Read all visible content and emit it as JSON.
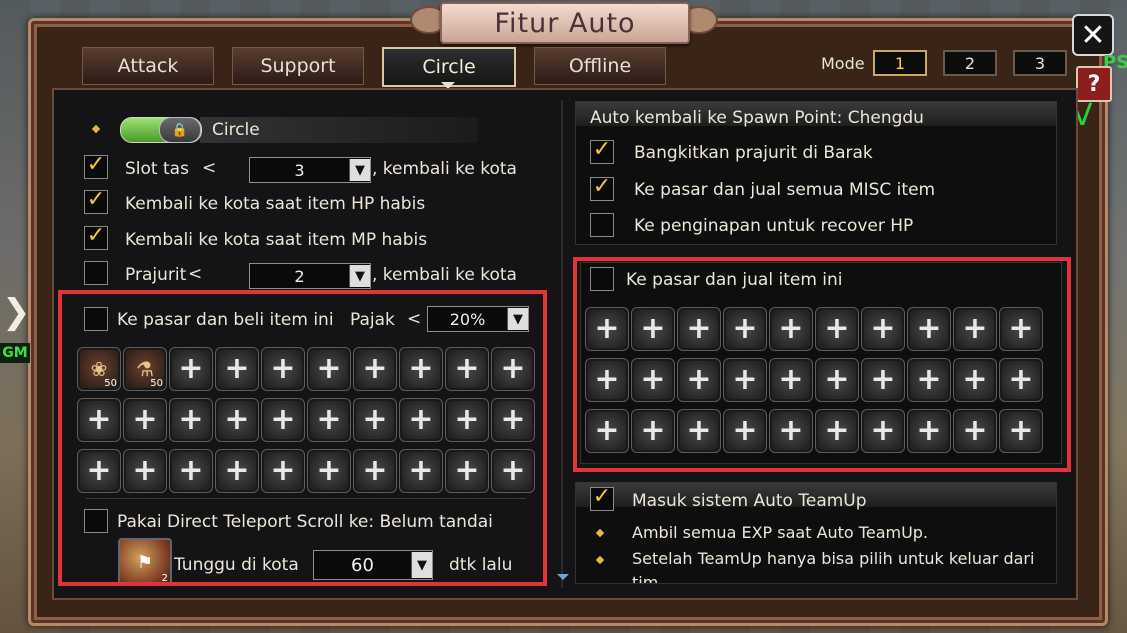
{
  "window": {
    "title": "Fitur Auto"
  },
  "tabs": [
    {
      "label": "Attack",
      "active": false
    },
    {
      "label": "Support",
      "active": false
    },
    {
      "label": "Circle",
      "active": true
    },
    {
      "label": "Offline",
      "active": false
    }
  ],
  "mode": {
    "label": "Mode",
    "options": [
      "1",
      "2",
      "3"
    ],
    "selected": "1"
  },
  "side": {
    "ps": "PS",
    "v": "V",
    "gm": "GM",
    "help": "?",
    "close": "✕"
  },
  "left": {
    "circle_toggle": {
      "label": "Circle",
      "on": true
    },
    "slot_row": {
      "checked": true,
      "label": "Slot tas",
      "op": "<",
      "value": "3",
      "suffix": ", kembali ke kota"
    },
    "hp_row": {
      "checked": true,
      "label": "Kembali ke kota saat item HP habis"
    },
    "mp_row": {
      "checked": true,
      "label": "Kembali ke kota saat item MP habis"
    },
    "soldier_row": {
      "checked": false,
      "label": "Prajurit",
      "op": "<",
      "value": "2",
      "suffix": ", kembali ke kota"
    },
    "buy": {
      "checked": false,
      "label": "Ke pasar dan beli item ini",
      "tax_label": "Pajak",
      "tax_op": "<",
      "tax_value": "20%",
      "items": [
        {
          "qty": "50",
          "icon": "hp-potion-icon"
        },
        {
          "qty": "50",
          "icon": "mp-potion-icon"
        }
      ]
    },
    "teleport": {
      "checked": false,
      "label": "Pakai Direct Teleport Scroll ke: Belum tandai",
      "scroll_qty": "2",
      "wait_label": "Tunggu di kota",
      "wait_value": "60",
      "wait_suffix": "dtk lalu"
    }
  },
  "right": {
    "spawn": {
      "header": "Auto kembali ke Spawn Point: Chengdu",
      "rows": [
        {
          "checked": true,
          "label": "Bangkitkan prajurit di Barak"
        },
        {
          "checked": true,
          "label": "Ke pasar dan jual semua MISC item"
        },
        {
          "checked": false,
          "label": "Ke penginapan untuk recover HP"
        }
      ]
    },
    "sell": {
      "checked": false,
      "label": "Ke pasar dan jual item ini"
    },
    "teamup": {
      "checked": true,
      "label": "Masuk sistem Auto TeamUp",
      "notes": [
        "Ambil semua EXP saat Auto TeamUp.",
        "Setelah TeamUp hanya bisa pilih untuk keluar dari",
        "tim"
      ]
    }
  }
}
